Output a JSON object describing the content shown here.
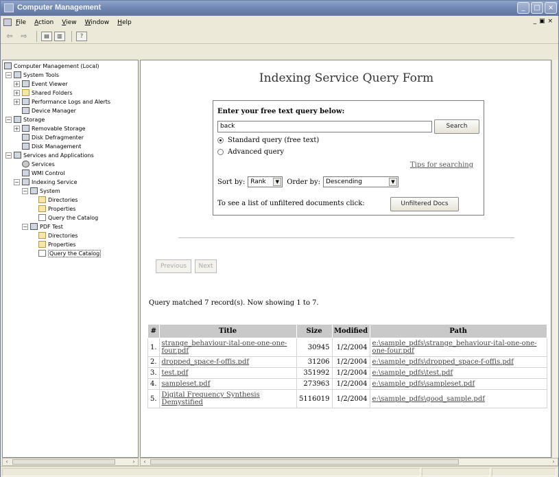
{
  "window": {
    "title": "Computer Management"
  },
  "menu": [
    "File",
    "Action",
    "View",
    "Window",
    "Help"
  ],
  "tree": {
    "items": [
      {
        "label": "Computer Management (Local)",
        "toggle": "",
        "icon": "computer-icon"
      },
      {
        "label": "System Tools",
        "toggle": "−",
        "icon": "tools-icon"
      },
      {
        "label": "Event Viewer",
        "toggle": "+",
        "icon": "event-viewer-icon"
      },
      {
        "label": "Shared Folders",
        "toggle": "+",
        "icon": "shared-folder-icon"
      },
      {
        "label": "Performance Logs and Alerts",
        "toggle": "+",
        "icon": "performance-icon"
      },
      {
        "label": "Device Manager",
        "toggle": "",
        "icon": "device-manager-icon"
      },
      {
        "label": "Storage",
        "toggle": "−",
        "icon": "storage-icon"
      },
      {
        "label": "Removable Storage",
        "toggle": "+",
        "icon": "removable-storage-icon"
      },
      {
        "label": "Disk Defragmenter",
        "toggle": "",
        "icon": "defrag-icon"
      },
      {
        "label": "Disk Management",
        "toggle": "",
        "icon": "disk-management-icon"
      },
      {
        "label": "Services and Applications",
        "toggle": "−",
        "icon": "services-apps-icon"
      },
      {
        "label": "Services",
        "toggle": "",
        "icon": "services-icon"
      },
      {
        "label": "WMI Control",
        "toggle": "",
        "icon": "wmi-icon"
      },
      {
        "label": "Indexing Service",
        "toggle": "−",
        "icon": "indexing-icon"
      },
      {
        "label": "System",
        "toggle": "−",
        "icon": "catalog-icon"
      },
      {
        "label": "Directories",
        "toggle": "",
        "icon": "folder-icon"
      },
      {
        "label": "Properties",
        "toggle": "",
        "icon": "folder-icon"
      },
      {
        "label": "Query the Catalog",
        "toggle": "",
        "icon": "query-icon"
      },
      {
        "label": "PDF Test",
        "toggle": "−",
        "icon": "catalog-icon"
      },
      {
        "label": "Directories",
        "toggle": "",
        "icon": "folder-icon"
      },
      {
        "label": "Properties",
        "toggle": "",
        "icon": "folder-icon"
      },
      {
        "label": "Query the Catalog",
        "toggle": "",
        "icon": "query-icon"
      }
    ]
  },
  "form": {
    "title": "Indexing Service Query Form",
    "prompt": "Enter your free text query below:",
    "query_value": "back",
    "search_label": "Search",
    "standard_label": "Standard query (free text)",
    "advanced_label": "Advanced query",
    "tips_label": "Tips for searching",
    "sort_by_label": "Sort by:",
    "sort_value": "Rank",
    "order_by_label": "Order by:",
    "order_value": "Descending",
    "unfiltered_text": "To see a list of unfiltered documents click:",
    "unfiltered_button": "Unfiltered Docs"
  },
  "pager": {
    "previous": "Previous",
    "next": "Next"
  },
  "results": {
    "summary": "Query matched 7 record(s). Now showing 1 to 7.",
    "headers": [
      "#",
      "Title",
      "Size",
      "Modified",
      "Path"
    ],
    "rows": [
      {
        "num": "1.",
        "title": "strange_behaviour-ital-one-one-one-four.pdf",
        "size": "30945",
        "modified": "1/2/2004",
        "path": "e:\\sample_pdfs\\strange_behaviour-ital-one-one-one-four.pdf"
      },
      {
        "num": "2.",
        "title": "dropped_space-f-offis.pdf",
        "size": "31206",
        "modified": "1/2/2004",
        "path": "e:\\sample_pdfs\\dropped_space-f-offis.pdf"
      },
      {
        "num": "3.",
        "title": "test.pdf",
        "size": "351992",
        "modified": "1/2/2004",
        "path": "e:\\sample_pdfs\\test.pdf"
      },
      {
        "num": "4.",
        "title": "sampleset.pdf",
        "size": "273963",
        "modified": "1/2/2004",
        "path": "e:\\sample_pdfs\\sampleset.pdf"
      },
      {
        "num": "5.",
        "title": "Digital Frequency Synthesis Demystified",
        "size": "5116019",
        "modified": "1/2/2004",
        "path": "e:\\sample_pdfs\\good_sample.pdf"
      }
    ]
  }
}
